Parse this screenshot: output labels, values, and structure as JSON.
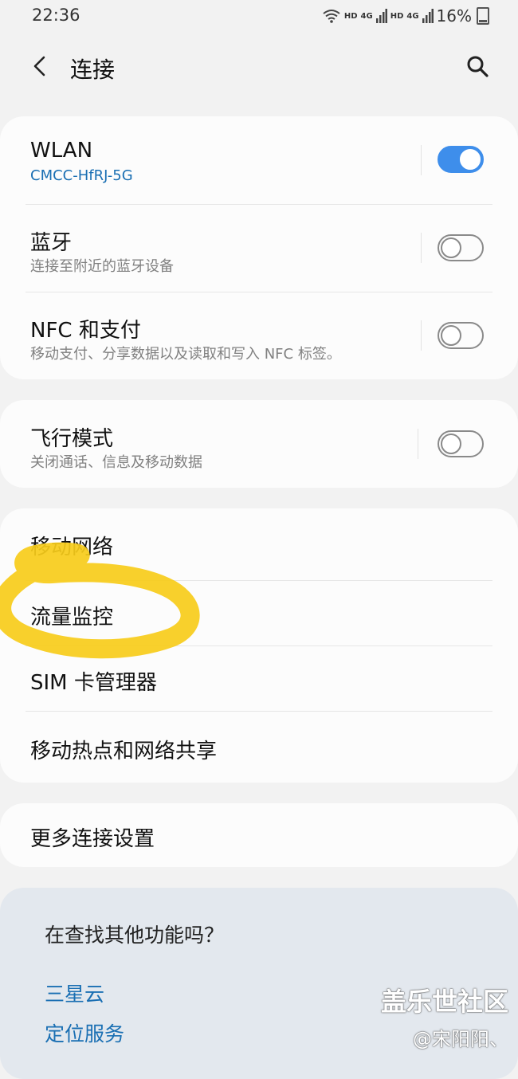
{
  "status_bar": {
    "time": "22:36",
    "net1": "4G",
    "net2": "4G",
    "hd1": "HD",
    "hd2": "HD",
    "battery": "16%"
  },
  "header": {
    "title": "连接",
    "back_icon": "back-arrow-icon",
    "search_icon": "search-icon"
  },
  "group1": {
    "wlan": {
      "title": "WLAN",
      "subtitle": "CMCC-HfRJ-5G",
      "enabled": true
    },
    "bluetooth": {
      "title": "蓝牙",
      "subtitle": "连接至附近的蓝牙设备",
      "enabled": false
    },
    "nfc": {
      "title": "NFC 和支付",
      "subtitle": "移动支付、分享数据以及读取和写入 NFC 标签。",
      "enabled": false
    }
  },
  "group2": {
    "airplane": {
      "title": "飞行模式",
      "subtitle": "关闭通话、信息及移动数据",
      "enabled": false
    }
  },
  "group3": {
    "items": [
      "移动网络",
      "流量监控",
      "SIM 卡管理器",
      "移动热点和网络共享"
    ]
  },
  "group4": {
    "more": "更多连接设置"
  },
  "suggestions": {
    "title": "在查找其他功能吗？",
    "links": [
      "三星云",
      "定位服务"
    ]
  },
  "watermark": {
    "line1": "盖乐世社区",
    "line2": "@宋阳阳、"
  },
  "colors": {
    "accent": "#3e8eeb",
    "link": "#1a6fb3",
    "highlight": "#f7cc1a"
  }
}
